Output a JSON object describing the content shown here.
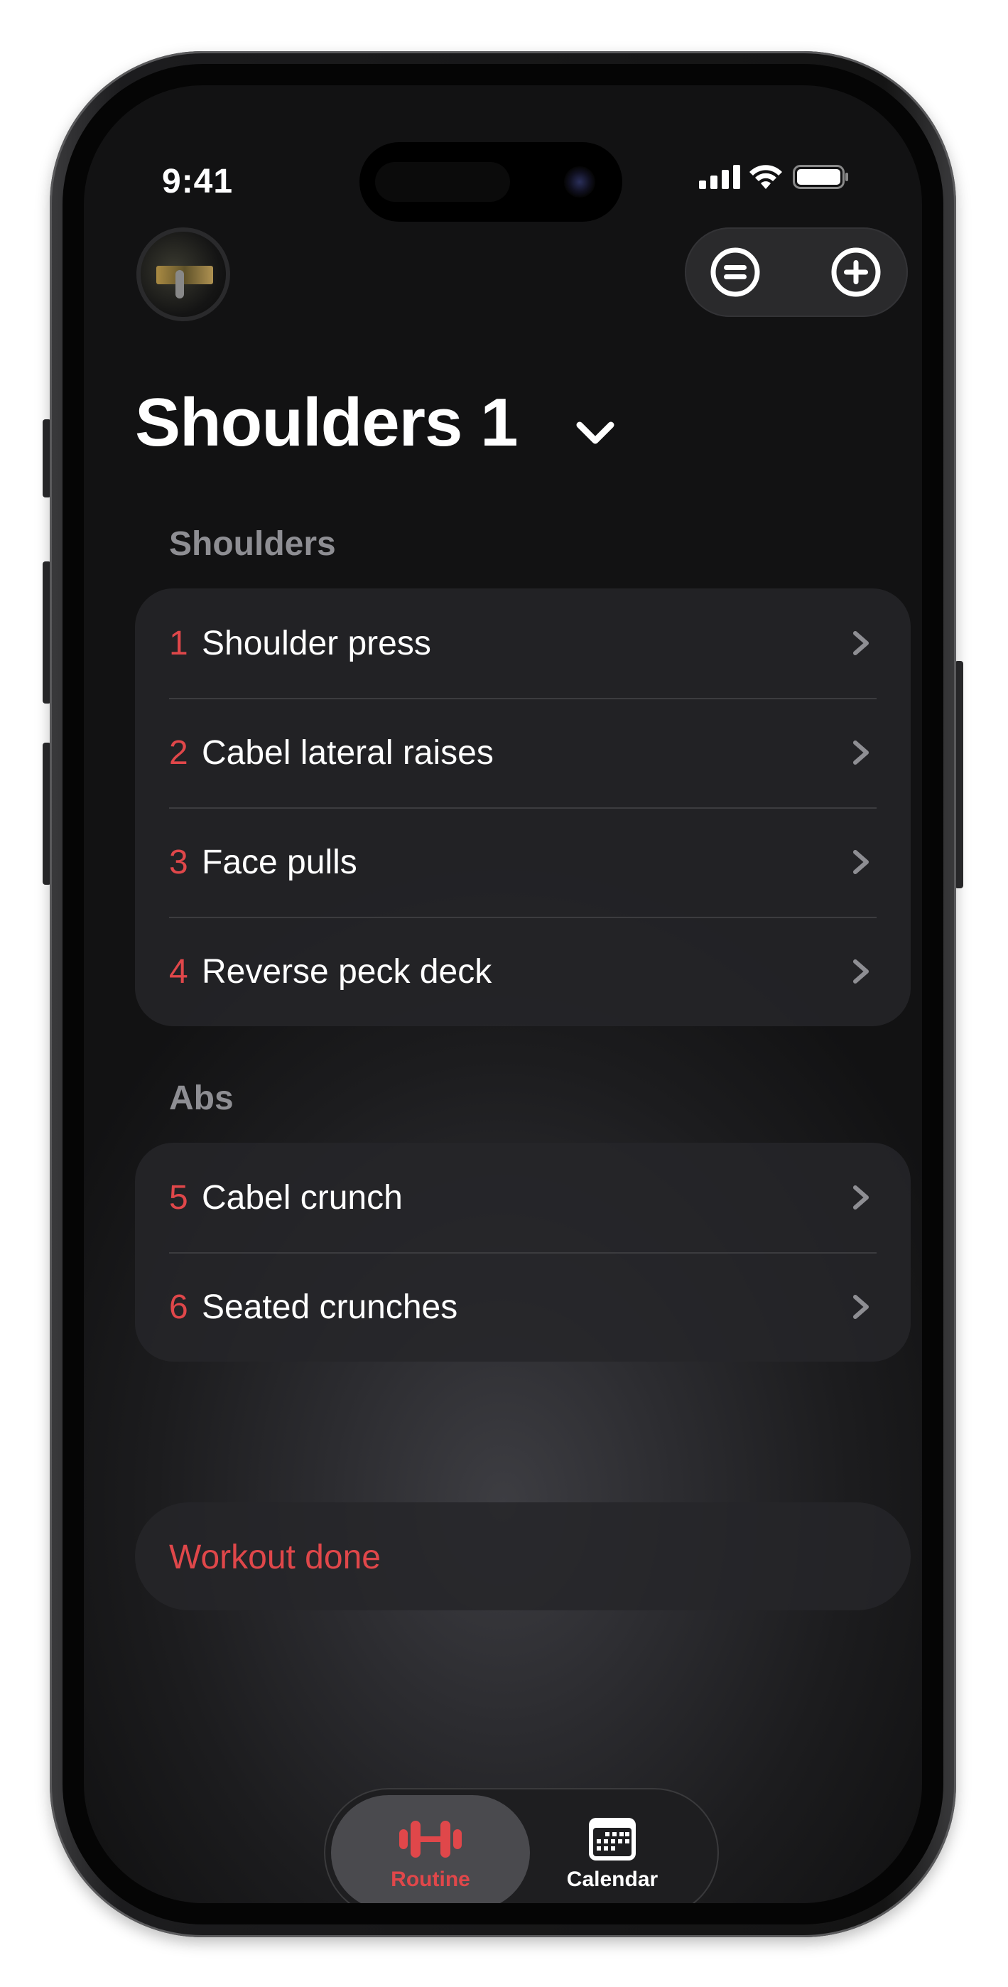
{
  "status_bar": {
    "time": "9:41"
  },
  "header": {
    "title": "Shoulders 1"
  },
  "sections": [
    {
      "heading": "Shoulders",
      "items": [
        {
          "number": "1",
          "name": "Shoulder press"
        },
        {
          "number": "2",
          "name": "Cabel lateral raises"
        },
        {
          "number": "3",
          "name": "Face pulls"
        },
        {
          "number": "4",
          "name": "Reverse peck deck"
        }
      ]
    },
    {
      "heading": "Abs",
      "items": [
        {
          "number": "5",
          "name": "Cabel crunch"
        },
        {
          "number": "6",
          "name": "Seated crunches"
        }
      ]
    }
  ],
  "actions": {
    "workout_done": "Workout done"
  },
  "tab_bar": {
    "tabs": [
      {
        "label": "Routine",
        "icon": "dumbbell-icon",
        "selected": true
      },
      {
        "label": "Calendar",
        "icon": "calendar-icon",
        "selected": false
      }
    ]
  },
  "colors": {
    "accent": "#e0474a",
    "background": "#1c1c1e",
    "card": "#262629",
    "muted_text": "#8e8e93"
  }
}
